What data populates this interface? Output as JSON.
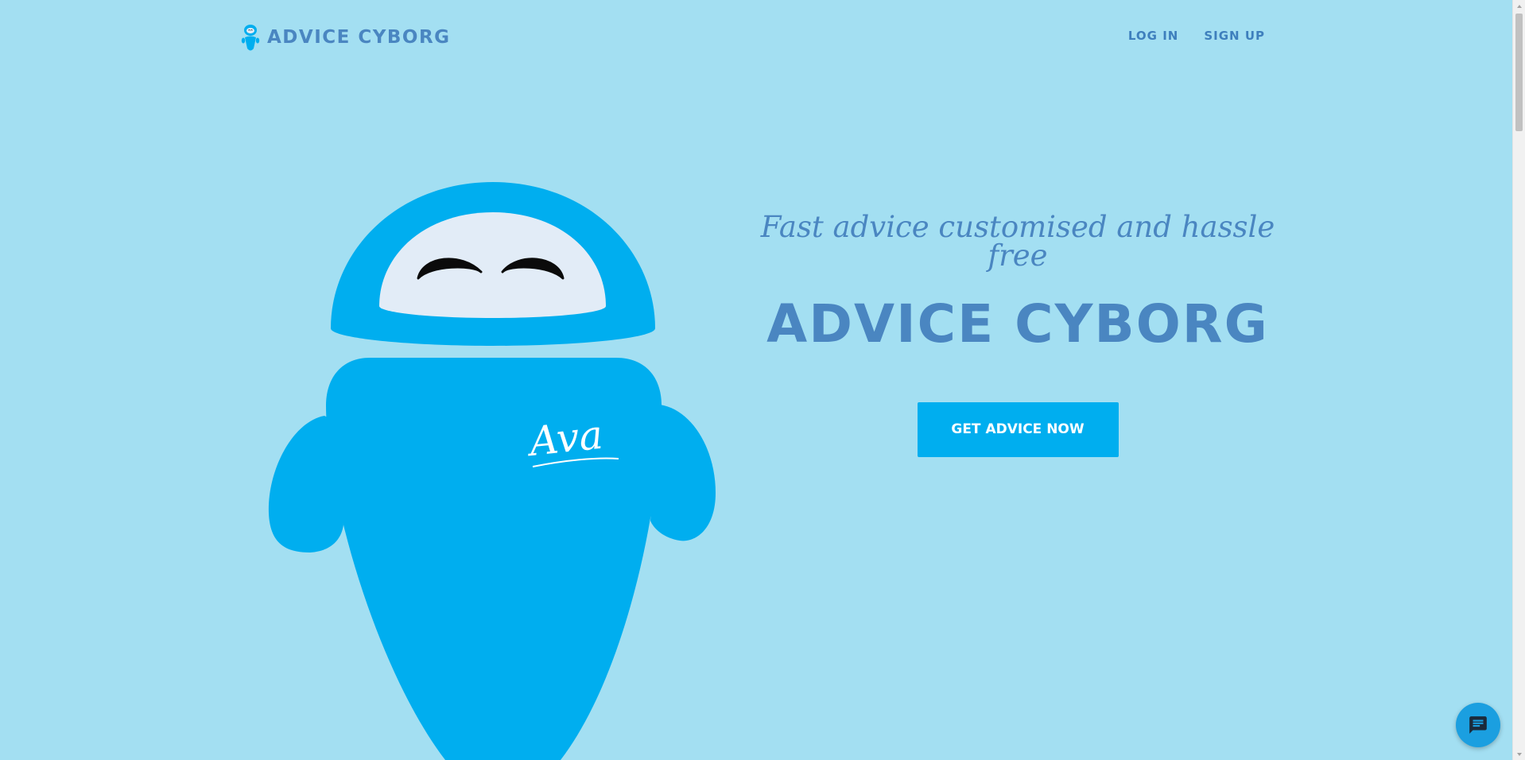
{
  "header": {
    "brand_name": "ADVICE CYBORG",
    "brand_icon": "robot-icon",
    "nav": [
      {
        "label": "LOG IN"
      },
      {
        "label": "SIGN UP"
      }
    ]
  },
  "hero": {
    "tagline": "Fast advice customised and hassle free",
    "headline": "ADVICE CYBORG",
    "cta_label": "GET ADVICE NOW"
  },
  "robot": {
    "name": "Ava"
  },
  "chat": {
    "icon": "chat-icon"
  },
  "colors": {
    "background": "#a3dff2",
    "brand_text": "#4a86c1",
    "accent": "#00aeef",
    "robot_body": "#00aeef",
    "robot_face": "#e2ecf7",
    "chat_button": "#1b9fe0"
  }
}
